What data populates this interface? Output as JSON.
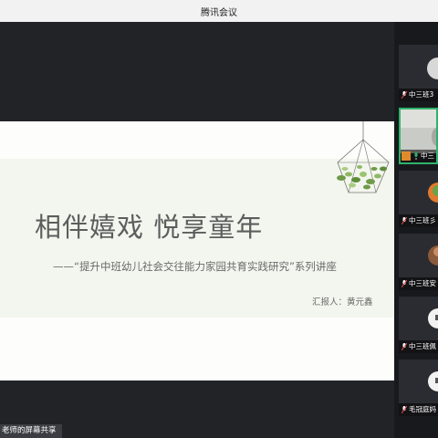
{
  "window": {
    "title": "腾讯会议"
  },
  "slide": {
    "title": "相伴嬉戏 悦享童年",
    "subtitle": "——“提升中班幼儿社会交往能力家园共育实践研究”系列讲座",
    "presenter": "汇报人：黄元鑫"
  },
  "share": {
    "label": "老师的屏幕共享"
  },
  "participants": [
    {
      "name": "中三班3",
      "avatar": "gray-light"
    },
    {
      "name": "中三",
      "avatar": "photo",
      "active": true
    },
    {
      "name": "中三班彡",
      "avatar": "orange"
    },
    {
      "name": "中三班安",
      "avatar": "brown"
    },
    {
      "name": "中三班佩",
      "avatar": "white"
    },
    {
      "name": "毛冠庭妈",
      "avatar": "white"
    }
  ],
  "colors": {
    "accent": "#2fb36b",
    "titlebar": "#f2f2f2",
    "stage": "#212327"
  }
}
